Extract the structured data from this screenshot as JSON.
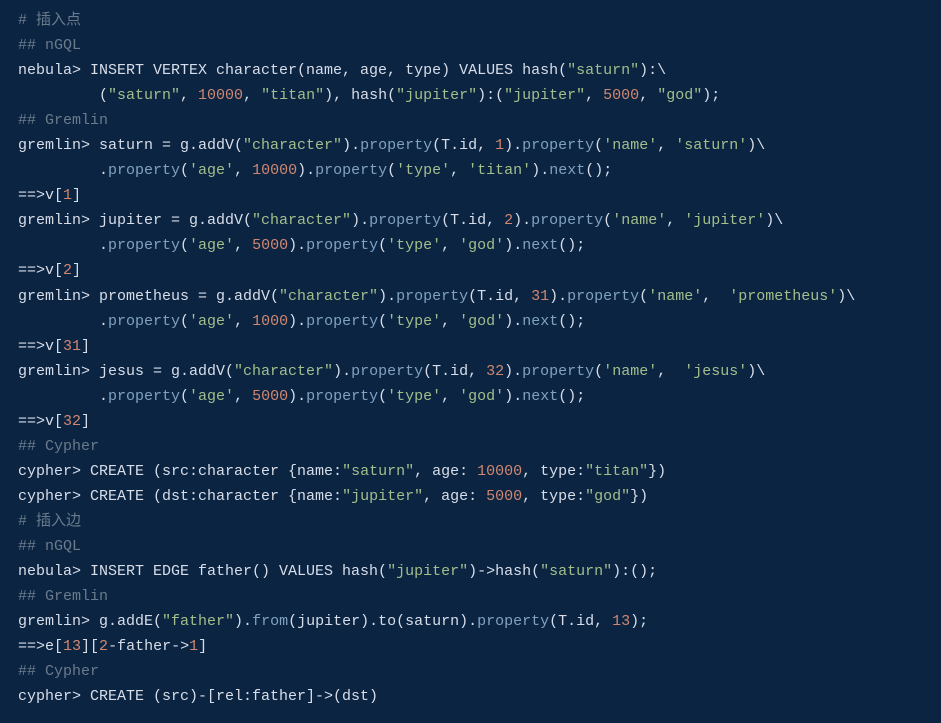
{
  "code": {
    "lines": [
      [
        {
          "cls": "c-comment",
          "t": "# 插入点"
        }
      ],
      [
        {
          "cls": "c-comment",
          "t": "## nGQL"
        }
      ],
      [
        {
          "cls": "c-plain",
          "t": "nebula> INSERT VERTEX character(name, age, type) VALUES hash("
        },
        {
          "cls": "c-string",
          "t": "\"saturn\""
        },
        {
          "cls": "c-plain",
          "t": "):\\"
        }
      ],
      [
        {
          "cls": "c-plain",
          "t": "         ("
        },
        {
          "cls": "c-string",
          "t": "\"saturn\""
        },
        {
          "cls": "c-plain",
          "t": ", "
        },
        {
          "cls": "c-number",
          "t": "10000"
        },
        {
          "cls": "c-plain",
          "t": ", "
        },
        {
          "cls": "c-string",
          "t": "\"titan\""
        },
        {
          "cls": "c-plain",
          "t": "), hash("
        },
        {
          "cls": "c-string",
          "t": "\"jupiter\""
        },
        {
          "cls": "c-plain",
          "t": "):("
        },
        {
          "cls": "c-string",
          "t": "\"jupiter\""
        },
        {
          "cls": "c-plain",
          "t": ", "
        },
        {
          "cls": "c-number",
          "t": "5000"
        },
        {
          "cls": "c-plain",
          "t": ", "
        },
        {
          "cls": "c-string",
          "t": "\"god\""
        },
        {
          "cls": "c-plain",
          "t": ");"
        }
      ],
      [
        {
          "cls": "c-comment",
          "t": "## Gremlin"
        }
      ],
      [
        {
          "cls": "c-plain",
          "t": "gremlin> saturn = g.addV("
        },
        {
          "cls": "c-string",
          "t": "\"character\""
        },
        {
          "cls": "c-plain",
          "t": ")."
        },
        {
          "cls": "c-keyword",
          "t": "property"
        },
        {
          "cls": "c-plain",
          "t": "(T.id, "
        },
        {
          "cls": "c-number",
          "t": "1"
        },
        {
          "cls": "c-plain",
          "t": ")."
        },
        {
          "cls": "c-keyword",
          "t": "property"
        },
        {
          "cls": "c-plain",
          "t": "("
        },
        {
          "cls": "c-string",
          "t": "'name'"
        },
        {
          "cls": "c-plain",
          "t": ", "
        },
        {
          "cls": "c-string",
          "t": "'saturn'"
        },
        {
          "cls": "c-plain",
          "t": ")\\"
        }
      ],
      [
        {
          "cls": "c-plain",
          "t": "         ."
        },
        {
          "cls": "c-keyword",
          "t": "property"
        },
        {
          "cls": "c-plain",
          "t": "("
        },
        {
          "cls": "c-string",
          "t": "'age'"
        },
        {
          "cls": "c-plain",
          "t": ", "
        },
        {
          "cls": "c-number",
          "t": "10000"
        },
        {
          "cls": "c-plain",
          "t": ")."
        },
        {
          "cls": "c-keyword",
          "t": "property"
        },
        {
          "cls": "c-plain",
          "t": "("
        },
        {
          "cls": "c-string",
          "t": "'type'"
        },
        {
          "cls": "c-plain",
          "t": ", "
        },
        {
          "cls": "c-string",
          "t": "'titan'"
        },
        {
          "cls": "c-plain",
          "t": ")."
        },
        {
          "cls": "c-keyword",
          "t": "next"
        },
        {
          "cls": "c-plain",
          "t": "();"
        }
      ],
      [
        {
          "cls": "c-plain",
          "t": "==>v["
        },
        {
          "cls": "c-number",
          "t": "1"
        },
        {
          "cls": "c-plain",
          "t": "]"
        }
      ],
      [
        {
          "cls": "c-plain",
          "t": "gremlin> jupiter = g.addV("
        },
        {
          "cls": "c-string",
          "t": "\"character\""
        },
        {
          "cls": "c-plain",
          "t": ")."
        },
        {
          "cls": "c-keyword",
          "t": "property"
        },
        {
          "cls": "c-plain",
          "t": "(T.id, "
        },
        {
          "cls": "c-number",
          "t": "2"
        },
        {
          "cls": "c-plain",
          "t": ")."
        },
        {
          "cls": "c-keyword",
          "t": "property"
        },
        {
          "cls": "c-plain",
          "t": "("
        },
        {
          "cls": "c-string",
          "t": "'name'"
        },
        {
          "cls": "c-plain",
          "t": ", "
        },
        {
          "cls": "c-string",
          "t": "'jupiter'"
        },
        {
          "cls": "c-plain",
          "t": ")\\"
        }
      ],
      [
        {
          "cls": "c-plain",
          "t": "         ."
        },
        {
          "cls": "c-keyword",
          "t": "property"
        },
        {
          "cls": "c-plain",
          "t": "("
        },
        {
          "cls": "c-string",
          "t": "'age'"
        },
        {
          "cls": "c-plain",
          "t": ", "
        },
        {
          "cls": "c-number",
          "t": "5000"
        },
        {
          "cls": "c-plain",
          "t": ")."
        },
        {
          "cls": "c-keyword",
          "t": "property"
        },
        {
          "cls": "c-plain",
          "t": "("
        },
        {
          "cls": "c-string",
          "t": "'type'"
        },
        {
          "cls": "c-plain",
          "t": ", "
        },
        {
          "cls": "c-string",
          "t": "'god'"
        },
        {
          "cls": "c-plain",
          "t": ")."
        },
        {
          "cls": "c-keyword",
          "t": "next"
        },
        {
          "cls": "c-plain",
          "t": "();"
        }
      ],
      [
        {
          "cls": "c-plain",
          "t": "==>v["
        },
        {
          "cls": "c-number",
          "t": "2"
        },
        {
          "cls": "c-plain",
          "t": "]"
        }
      ],
      [
        {
          "cls": "c-plain",
          "t": "gremlin> prometheus = g.addV("
        },
        {
          "cls": "c-string",
          "t": "\"character\""
        },
        {
          "cls": "c-plain",
          "t": ")."
        },
        {
          "cls": "c-keyword",
          "t": "property"
        },
        {
          "cls": "c-plain",
          "t": "(T.id, "
        },
        {
          "cls": "c-number",
          "t": "31"
        },
        {
          "cls": "c-plain",
          "t": ")."
        },
        {
          "cls": "c-keyword",
          "t": "property"
        },
        {
          "cls": "c-plain",
          "t": "("
        },
        {
          "cls": "c-string",
          "t": "'name'"
        },
        {
          "cls": "c-plain",
          "t": ",  "
        },
        {
          "cls": "c-string",
          "t": "'prometheus'"
        },
        {
          "cls": "c-plain",
          "t": ")\\"
        }
      ],
      [
        {
          "cls": "c-plain",
          "t": "         ."
        },
        {
          "cls": "c-keyword",
          "t": "property"
        },
        {
          "cls": "c-plain",
          "t": "("
        },
        {
          "cls": "c-string",
          "t": "'age'"
        },
        {
          "cls": "c-plain",
          "t": ", "
        },
        {
          "cls": "c-number",
          "t": "1000"
        },
        {
          "cls": "c-plain",
          "t": ")."
        },
        {
          "cls": "c-keyword",
          "t": "property"
        },
        {
          "cls": "c-plain",
          "t": "("
        },
        {
          "cls": "c-string",
          "t": "'type'"
        },
        {
          "cls": "c-plain",
          "t": ", "
        },
        {
          "cls": "c-string",
          "t": "'god'"
        },
        {
          "cls": "c-plain",
          "t": ")."
        },
        {
          "cls": "c-keyword",
          "t": "next"
        },
        {
          "cls": "c-plain",
          "t": "();"
        }
      ],
      [
        {
          "cls": "c-plain",
          "t": "==>v["
        },
        {
          "cls": "c-number",
          "t": "31"
        },
        {
          "cls": "c-plain",
          "t": "]"
        }
      ],
      [
        {
          "cls": "c-plain",
          "t": "gremlin> jesus = g.addV("
        },
        {
          "cls": "c-string",
          "t": "\"character\""
        },
        {
          "cls": "c-plain",
          "t": ")."
        },
        {
          "cls": "c-keyword",
          "t": "property"
        },
        {
          "cls": "c-plain",
          "t": "(T.id, "
        },
        {
          "cls": "c-number",
          "t": "32"
        },
        {
          "cls": "c-plain",
          "t": ")."
        },
        {
          "cls": "c-keyword",
          "t": "property"
        },
        {
          "cls": "c-plain",
          "t": "("
        },
        {
          "cls": "c-string",
          "t": "'name'"
        },
        {
          "cls": "c-plain",
          "t": ",  "
        },
        {
          "cls": "c-string",
          "t": "'jesus'"
        },
        {
          "cls": "c-plain",
          "t": ")\\"
        }
      ],
      [
        {
          "cls": "c-plain",
          "t": "         ."
        },
        {
          "cls": "c-keyword",
          "t": "property"
        },
        {
          "cls": "c-plain",
          "t": "("
        },
        {
          "cls": "c-string",
          "t": "'age'"
        },
        {
          "cls": "c-plain",
          "t": ", "
        },
        {
          "cls": "c-number",
          "t": "5000"
        },
        {
          "cls": "c-plain",
          "t": ")."
        },
        {
          "cls": "c-keyword",
          "t": "property"
        },
        {
          "cls": "c-plain",
          "t": "("
        },
        {
          "cls": "c-string",
          "t": "'type'"
        },
        {
          "cls": "c-plain",
          "t": ", "
        },
        {
          "cls": "c-string",
          "t": "'god'"
        },
        {
          "cls": "c-plain",
          "t": ")."
        },
        {
          "cls": "c-keyword",
          "t": "next"
        },
        {
          "cls": "c-plain",
          "t": "();"
        }
      ],
      [
        {
          "cls": "c-plain",
          "t": "==>v["
        },
        {
          "cls": "c-number",
          "t": "32"
        },
        {
          "cls": "c-plain",
          "t": "]"
        }
      ],
      [
        {
          "cls": "c-comment",
          "t": "## Cypher"
        }
      ],
      [
        {
          "cls": "c-plain",
          "t": "cypher> CREATE (src:character {name:"
        },
        {
          "cls": "c-string",
          "t": "\"saturn\""
        },
        {
          "cls": "c-plain",
          "t": ", age: "
        },
        {
          "cls": "c-number",
          "t": "10000"
        },
        {
          "cls": "c-plain",
          "t": ", type:"
        },
        {
          "cls": "c-string",
          "t": "\"titan\""
        },
        {
          "cls": "c-plain",
          "t": "})"
        }
      ],
      [
        {
          "cls": "c-plain",
          "t": "cypher> CREATE (dst:character {name:"
        },
        {
          "cls": "c-string",
          "t": "\"jupiter\""
        },
        {
          "cls": "c-plain",
          "t": ", age: "
        },
        {
          "cls": "c-number",
          "t": "5000"
        },
        {
          "cls": "c-plain",
          "t": ", type:"
        },
        {
          "cls": "c-string",
          "t": "\"god\""
        },
        {
          "cls": "c-plain",
          "t": "})"
        }
      ],
      [
        {
          "cls": "c-comment",
          "t": "# 插入边"
        }
      ],
      [
        {
          "cls": "c-comment",
          "t": "## nGQL"
        }
      ],
      [
        {
          "cls": "c-plain",
          "t": "nebula> INSERT EDGE father() VALUES hash("
        },
        {
          "cls": "c-string",
          "t": "\"jupiter\""
        },
        {
          "cls": "c-plain",
          "t": ")->hash("
        },
        {
          "cls": "c-string",
          "t": "\"saturn\""
        },
        {
          "cls": "c-plain",
          "t": "):();"
        }
      ],
      [
        {
          "cls": "c-comment",
          "t": "## Gremlin"
        }
      ],
      [
        {
          "cls": "c-plain",
          "t": "gremlin> g.addE("
        },
        {
          "cls": "c-string",
          "t": "\"father\""
        },
        {
          "cls": "c-plain",
          "t": ")."
        },
        {
          "cls": "c-keyword",
          "t": "from"
        },
        {
          "cls": "c-plain",
          "t": "(jupiter).to(saturn)."
        },
        {
          "cls": "c-keyword",
          "t": "property"
        },
        {
          "cls": "c-plain",
          "t": "(T.id, "
        },
        {
          "cls": "c-number",
          "t": "13"
        },
        {
          "cls": "c-plain",
          "t": ");"
        }
      ],
      [
        {
          "cls": "c-plain",
          "t": "==>e["
        },
        {
          "cls": "c-number",
          "t": "13"
        },
        {
          "cls": "c-plain",
          "t": "]["
        },
        {
          "cls": "c-number",
          "t": "2"
        },
        {
          "cls": "c-plain",
          "t": "-father->"
        },
        {
          "cls": "c-number",
          "t": "1"
        },
        {
          "cls": "c-plain",
          "t": "]"
        }
      ],
      [
        {
          "cls": "c-comment",
          "t": "## Cypher"
        }
      ],
      [
        {
          "cls": "c-plain",
          "t": "cypher> CREATE (src)-[rel:father]->(dst)"
        }
      ]
    ]
  }
}
